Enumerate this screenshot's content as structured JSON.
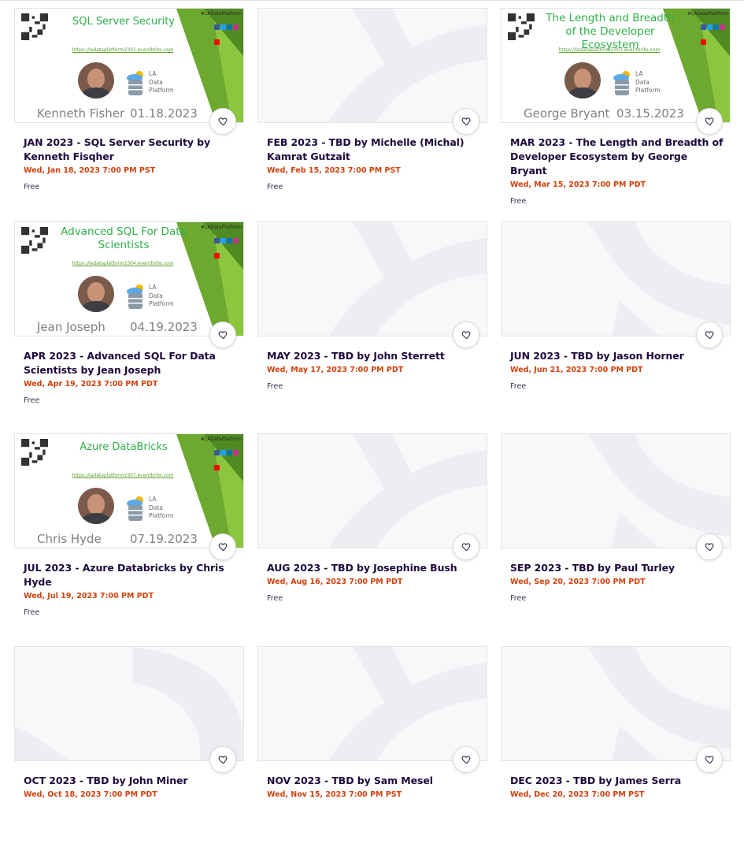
{
  "events": [
    {
      "title": "JAN 2023 - SQL Server Security by Kenneth Fisqher",
      "date": "Wed, Jan 18, 2023 7:00 PM PST",
      "price": "Free",
      "banner": {
        "heading": "SQL Server Security",
        "url": "https://ladataplatform2301.eventbrite.com",
        "name": "Kenneth Fisher",
        "date": "01.18.2023"
      }
    },
    {
      "title": "FEB 2023 - TBD by Michelle (Michal) Kamrat Gutzait",
      "date": "Wed, Feb 15, 2023 7:00 PM PST",
      "price": "Free",
      "banner": null
    },
    {
      "title": "MAR 2023 - The Length and Breadth of Developer Ecosystem by George Bryant",
      "date": "Wed, Mar 15, 2023 7:00 PM PDT",
      "price": "Free",
      "banner": {
        "heading": "The Length and Breadth of the Developer Ecosystem",
        "url": "https://ladataplatform2303.eventbrite.com",
        "name": "George Bryant",
        "date": "03.15.2023"
      }
    },
    {
      "title": "APR 2023 - Advanced SQL For Data Scientists by Jean Joseph",
      "date": "Wed, Apr 19, 2023 7:00 PM PDT",
      "price": "Free",
      "banner": {
        "heading": "Advanced SQL For Data Scientists",
        "url": "https://ladataplatform2304.eventbrite.com",
        "name": "Jean Joseph",
        "date": "04.19.2023"
      }
    },
    {
      "title": "MAY 2023 - TBD by John Sterrett",
      "date": "Wed, May 17, 2023 7:00 PM PDT",
      "price": "Free",
      "banner": null
    },
    {
      "title": "JUN 2023 - TBD by Jason Horner",
      "date": "Wed, Jun 21, 2023 7:00 PM PDT",
      "price": "Free",
      "banner": null
    },
    {
      "title": "JUL 2023 - Azure Databricks by Chris Hyde",
      "date": "Wed, Jul 19, 2023 7:00 PM PDT",
      "price": "Free",
      "banner": {
        "heading": "Azure DataBricks",
        "url": "https://ladataplatform2307.eventbrite.com",
        "name": "Chris Hyde",
        "date": "07.19.2023"
      }
    },
    {
      "title": "AUG 2023 - TBD by Josephine Bush",
      "date": "Wed, Aug 16, 2023 7:00 PM PDT",
      "price": "Free",
      "banner": null
    },
    {
      "title": "SEP 2023 - TBD by Paul Turley",
      "date": "Wed, Sep 20, 2023 7:00 PM PDT",
      "price": "Free",
      "banner": null
    },
    {
      "title": "OCT 2023 - TBD by John Miner",
      "date": "Wed, Oct 18, 2023 7:00 PM PDT",
      "price": "",
      "banner": null
    },
    {
      "title": "NOV 2023 - TBD by Sam Mesel",
      "date": "Wed, Nov 15, 2023 7:00 PM PST",
      "price": "",
      "banner": null
    },
    {
      "title": "DEC 2023 - TBD by James Serra",
      "date": "Wed, Dec 20, 2023 7:00 PM PST",
      "price": "",
      "banner": null
    }
  ],
  "banner_common": {
    "hashtag": "#LADataPlatform",
    "ladp": [
      "LA",
      "Data",
      "Platform"
    ]
  },
  "colors": {
    "date": "#d1410c",
    "title": "#1e0a3c",
    "placeholder_bg": "#f8f7fa",
    "placeholder_shape": "#eeedf2",
    "banner_green": "#2fb04a"
  }
}
